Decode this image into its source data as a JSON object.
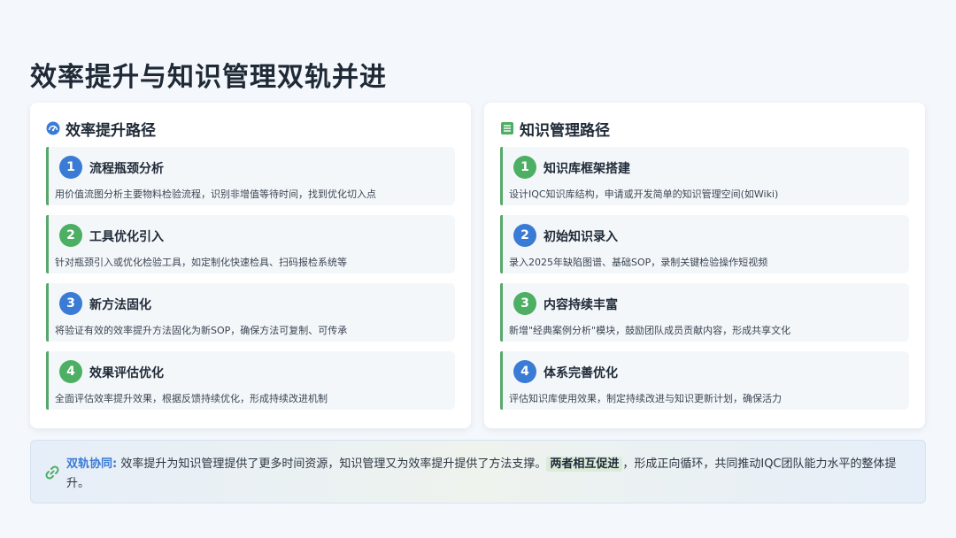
{
  "page": {
    "title": "效率提升与知识管理双轨并进"
  },
  "left_panel": {
    "title": "效率提升路径",
    "icon": "gauge-icon",
    "steps": [
      {
        "num": "1",
        "title": "流程瓶颈分析",
        "desc": "用价值流图分析主要物料检验流程，识别非增值等待时间，找到优化切入点"
      },
      {
        "num": "2",
        "title": "工具优化引入",
        "desc": "针对瓶颈引入或优化检验工具，如定制化快速检具、扫码报检系统等"
      },
      {
        "num": "3",
        "title": "新方法固化",
        "desc": "将验证有效的效率提升方法固化为新SOP，确保方法可复制、可传承"
      },
      {
        "num": "4",
        "title": "效果评估优化",
        "desc": "全面评估效率提升效果，根据反馈持续优化，形成持续改进机制"
      }
    ]
  },
  "right_panel": {
    "title": "知识管理路径",
    "icon": "list-icon",
    "steps": [
      {
        "num": "1",
        "title": "知识库框架搭建",
        "desc": "设计IQC知识库结构，申请或开发简单的知识管理空间(如Wiki)"
      },
      {
        "num": "2",
        "title": "初始知识录入",
        "desc": "录入2025年缺陷图谱、基础SOP，录制关键检验操作短视频"
      },
      {
        "num": "3",
        "title": "内容持续丰富",
        "desc": "新增\"经典案例分析\"模块，鼓励团队成员贡献内容，形成共享文化"
      },
      {
        "num": "4",
        "title": "体系完善优化",
        "desc": "评估知识库使用效果，制定持续改进与知识更新计划，确保活力"
      }
    ]
  },
  "footer": {
    "label": "双轨协同:",
    "text_before": " 效率提升为知识管理提供了更多时间资源，知识管理又为效率提升提供了方法支撑。",
    "highlight": "两者相互促进",
    "text_after": "，形成正向循环，共同推动IQC团队能力水平的整体提升。",
    "icon": "link-icon"
  },
  "colors": {
    "accent_blue": "#3a7bd5",
    "accent_green": "#4caf63",
    "step_border": "#57a96b"
  }
}
